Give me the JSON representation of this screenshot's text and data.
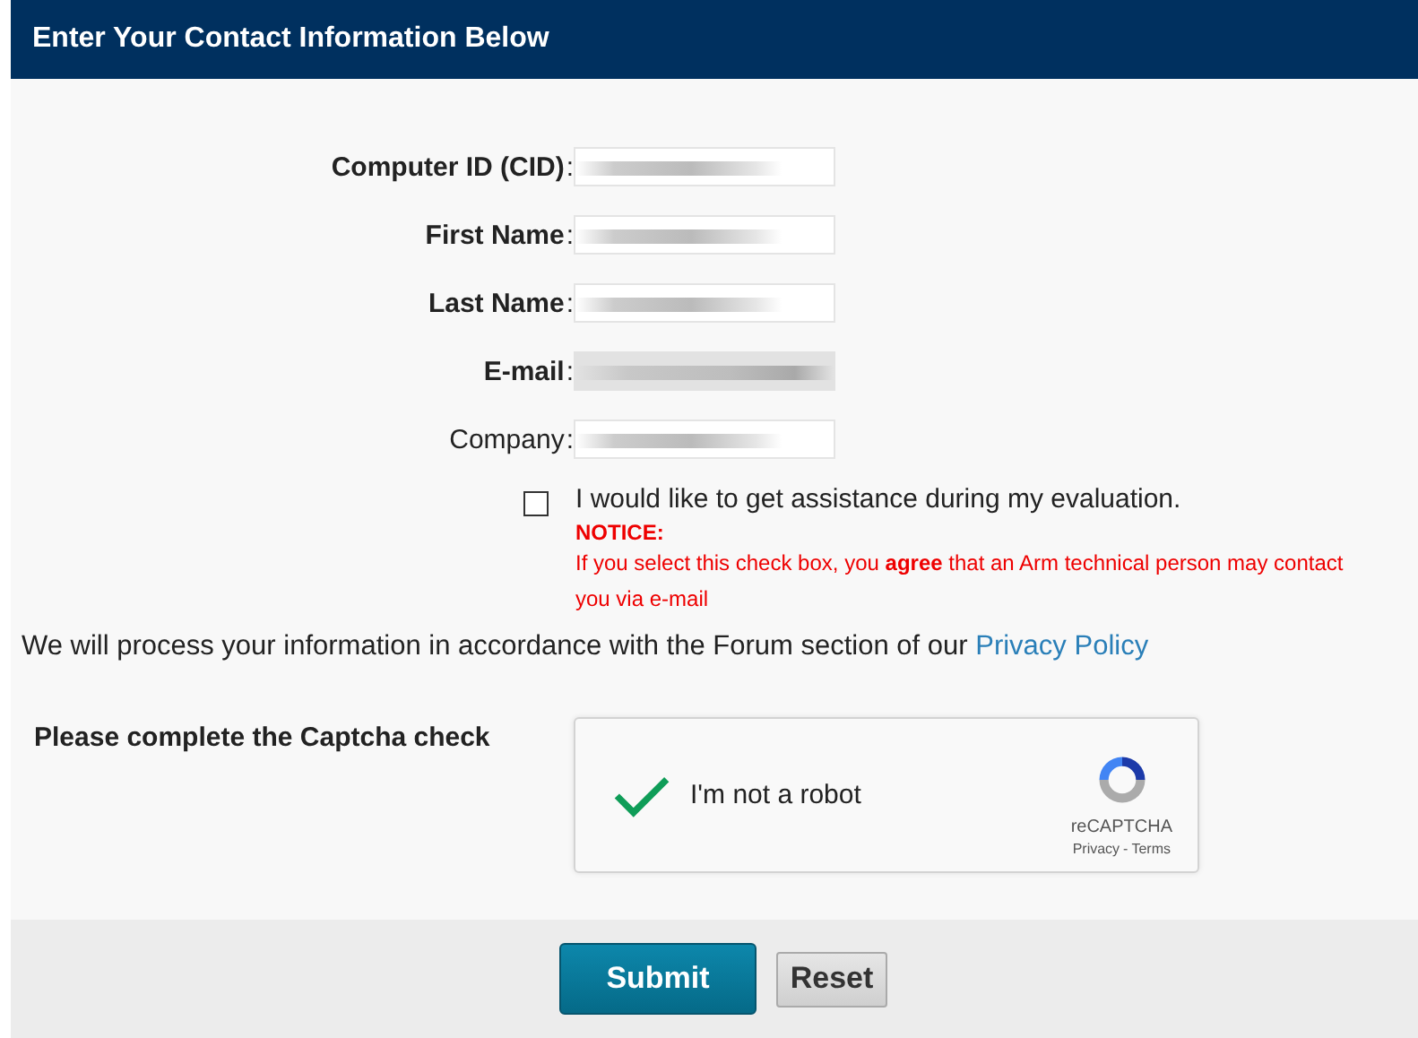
{
  "header": {
    "title": "Enter Your Contact Information Below"
  },
  "fields": [
    {
      "label": "Computer ID (CID)",
      "separator": ":",
      "required": true,
      "autofilled": false
    },
    {
      "label": "First Name",
      "separator": ":",
      "required": true,
      "autofilled": false
    },
    {
      "label": "Last Name",
      "separator": ":",
      "required": true,
      "autofilled": false
    },
    {
      "label": "E-mail",
      "separator": ":",
      "required": true,
      "autofilled": true
    },
    {
      "label": "Company",
      "separator": ":",
      "required": false,
      "autofilled": false
    }
  ],
  "assistance": {
    "checked": false,
    "label": "I would like to get assistance during my evaluation.",
    "notice_title": "NOTICE:",
    "notice": "If you select this check box, you **agree** that an Arm technical person may contact you via e-mail"
  },
  "privacy": {
    "text": "We will process your information in accordance with the Forum section of our",
    "link": "Privacy Policy"
  },
  "captcha": {
    "prompt": "Please complete the Captcha check",
    "checked": true,
    "label": "I'm not a robot",
    "brand": "reCAPTCHA",
    "privacy": "Privacy",
    "separator": "-",
    "terms": "Terms"
  },
  "buttons": [
    {
      "label": "Submit",
      "kind": "primary"
    },
    {
      "label": "Reset",
      "kind": "secondary"
    }
  ]
}
